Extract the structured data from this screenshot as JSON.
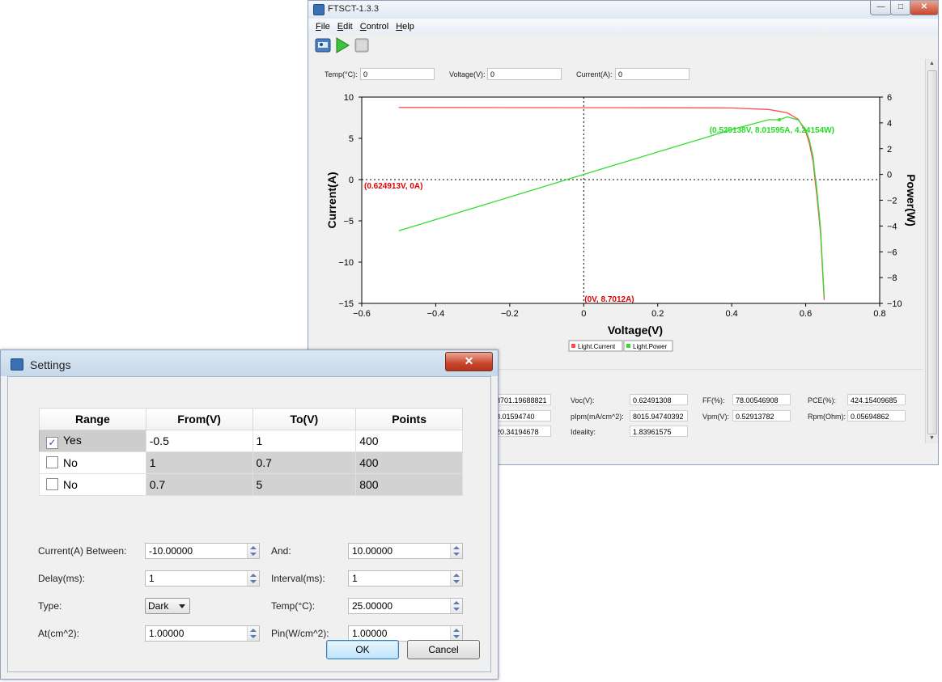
{
  "main_window": {
    "title": "FTSCT-1.3.3",
    "menu": [
      "File",
      "Edit",
      "Control",
      "Help"
    ],
    "toolbar": {
      "connect_icon": "device-icon",
      "run_icon": "play-icon",
      "stop_icon": "stop-icon"
    },
    "live": {
      "temp_label": "Temp(°C):",
      "temp_value": "0",
      "voltage_label": "Voltage(V):",
      "voltage_value": "0",
      "current_label": "Current(A):",
      "current_value": "0"
    },
    "results": {
      "col1_values": [
        "8701.19688821",
        "8.01594740",
        "20.34194678"
      ],
      "voc_label": "Voc(V):",
      "voc_value": "0.62491308",
      "plpm_label": "pIpm(mA/cm^2):",
      "plpm_value": "8015.94740392",
      "ideality_label": "Ideality:",
      "ideality_value": "1.83961575",
      "ff_label": "FF(%):",
      "ff_value": "78.00546908",
      "vpm_label": "Vpm(V):",
      "vpm_value": "0.52913782",
      "pce_label": "PCE(%):",
      "pce_value": "424.15409685",
      "rpm_label": "Rpm(Ohm):",
      "rpm_value": "0.05694862"
    }
  },
  "chart_data": {
    "type": "line",
    "xlabel": "Voltage(V)",
    "ylabel": "Current(A)",
    "y2label": "Power(W)",
    "xlim": [
      -0.6,
      0.8
    ],
    "ylim": [
      -15,
      10
    ],
    "y2lim": [
      -10,
      6
    ],
    "xticks": [
      "-0.6",
      "-0.4",
      "-0.2",
      "0",
      "0.2",
      "0.4",
      "0.6",
      "0.8"
    ],
    "yticks": [
      "10",
      "5",
      "0",
      "-5",
      "-10",
      "-15"
    ],
    "y2ticks": [
      "6",
      "4",
      "2",
      "0",
      "-2",
      "-4",
      "-6",
      "-8",
      "-10"
    ],
    "legend": [
      "Light.Current",
      "Light.Power"
    ],
    "legend_position": "bottom-center",
    "colors": {
      "current": "#ff4d4d",
      "power": "#33dd33",
      "annot_red": "#e00000",
      "annot_green": "#22dd22"
    },
    "series": [
      {
        "name": "Light.Current",
        "axis": "left",
        "x": [
          -0.5,
          -0.2,
          0.0,
          0.2,
          0.4,
          0.5,
          0.55,
          0.58,
          0.6,
          0.61,
          0.62,
          0.625,
          0.63,
          0.64,
          0.65
        ],
        "y": [
          8.75,
          8.73,
          8.72,
          8.71,
          8.68,
          8.5,
          8.1,
          7.3,
          5.8,
          4.4,
          2.2,
          0.0,
          -1.8,
          -6.5,
          -14.6
        ]
      },
      {
        "name": "Light.Power",
        "axis": "right",
        "x": [
          -0.5,
          -0.2,
          0.0,
          0.2,
          0.4,
          0.5,
          0.529,
          0.55,
          0.58,
          0.6,
          0.61,
          0.62,
          0.625,
          0.63,
          0.64,
          0.65
        ],
        "y": [
          -4.37,
          -1.75,
          0.0,
          1.74,
          3.47,
          4.25,
          4.24,
          4.46,
          4.23,
          3.48,
          2.68,
          1.36,
          0.0,
          -1.13,
          -4.16,
          -9.49
        ]
      }
    ],
    "annotations": [
      {
        "text": "(0.624913V, 0A)",
        "color": "red"
      },
      {
        "text": "(0V, 8.7012A)",
        "color": "red"
      },
      {
        "text": "(0.529138V, 8.01595A, 4.24154W)",
        "color": "green"
      }
    ]
  },
  "dialog": {
    "title": "Settings",
    "table": {
      "headers": [
        "Range",
        "From(V)",
        "To(V)",
        "Points"
      ],
      "rows": [
        {
          "checked": true,
          "range": "Yes",
          "from": "-0.5",
          "to": "1",
          "points": "400"
        },
        {
          "checked": false,
          "range": "No",
          "from": "1",
          "to": "0.7",
          "points": "400"
        },
        {
          "checked": false,
          "range": "No",
          "from": "0.7",
          "to": "5",
          "points": "800"
        }
      ]
    },
    "current_between_label": "Current(A) Between:",
    "current_between_value": "-10.00000",
    "and_label": "And:",
    "and_value": "10.00000",
    "delay_label": "Delay(ms):",
    "delay_value": "1",
    "interval_label": "Interval(ms):",
    "interval_value": "1",
    "type_label": "Type:",
    "type_value": "Dark",
    "temp_label": "Temp(°C):",
    "temp_value": "25.00000",
    "at_label": "At(cm^2):",
    "at_value": "1.00000",
    "pin_label": "Pin(W/cm^2):",
    "pin_value": "1.00000",
    "ok_label": "OK",
    "cancel_label": "Cancel"
  }
}
